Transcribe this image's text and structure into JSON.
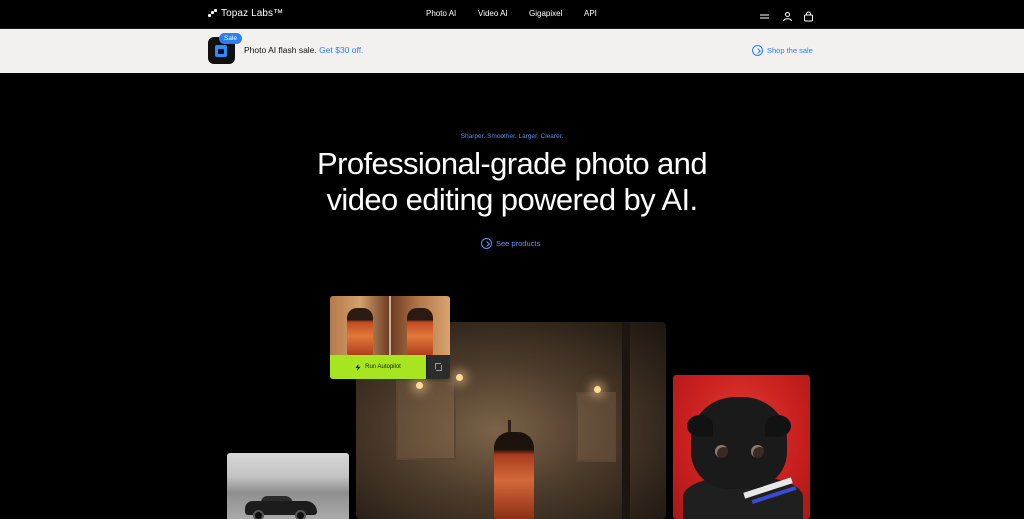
{
  "nav": {
    "brand": "Topaz Labs™",
    "links": [
      "Photo AI",
      "Video AI",
      "Gigapixel",
      "API"
    ],
    "icons": [
      "menu-icon",
      "account-icon",
      "cart-icon"
    ]
  },
  "banner": {
    "badge": "Sale",
    "text": "Photo AI flash sale.",
    "link_text": "Get $30 off.",
    "cta": "Shop the sale"
  },
  "hero": {
    "kicker": "Sharper. Smoother. Larger. Clearer.",
    "headline_line1": "Professional-grade photo and",
    "headline_line2": "video editing powered by AI.",
    "cta": "See products"
  },
  "showcase": {
    "autopilot_label": "Run Autopilot"
  },
  "colors": {
    "accent_blue": "#2d7df6",
    "autopilot_green": "#a6e51f",
    "banner_bg": "#f2f1ee",
    "page_bg": "#000000"
  }
}
